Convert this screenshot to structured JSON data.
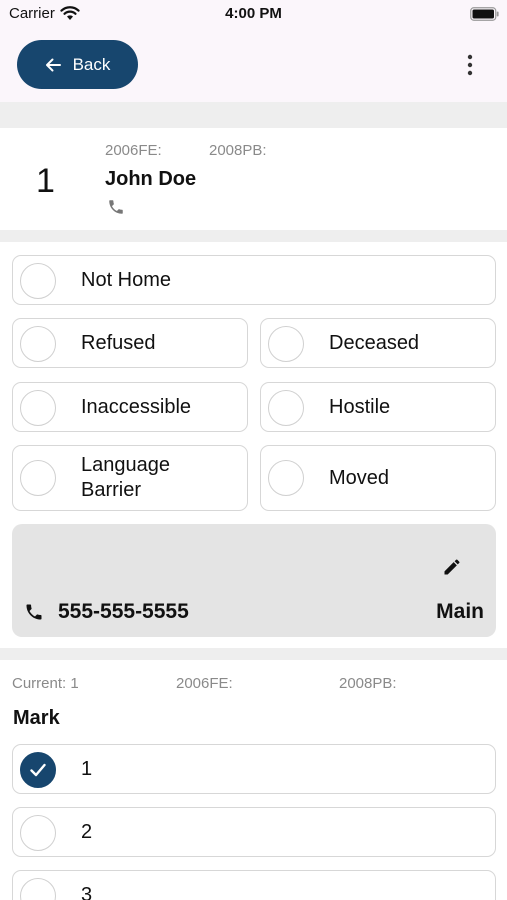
{
  "status_bar": {
    "carrier": "Carrier",
    "time": "4:00 PM"
  },
  "header": {
    "back_label": "Back"
  },
  "household": {
    "number": "1",
    "code_fe": "2006FE:",
    "code_pb": "2008PB:",
    "name": "John Doe"
  },
  "outcomes": [
    {
      "label": "Not Home",
      "selected": false
    },
    {
      "label": "Refused",
      "selected": false
    },
    {
      "label": "Deceased",
      "selected": false
    },
    {
      "label": "Inaccessible",
      "selected": false
    },
    {
      "label": "Hostile",
      "selected": false
    },
    {
      "label": "Language Barrier",
      "selected": false
    },
    {
      "label": "Moved",
      "selected": false
    }
  ],
  "phone": {
    "number": "555-555-5555",
    "type": "Main"
  },
  "mark_section": {
    "current": "Current: 1",
    "code_fe": "2006FE:",
    "code_pb": "2008PB:",
    "heading": "Mark",
    "options": [
      {
        "label": "1",
        "selected": true
      },
      {
        "label": "2",
        "selected": false
      },
      {
        "label": "3",
        "selected": false
      }
    ]
  },
  "colors": {
    "primary": "#17466e",
    "header_bg": "#fbf6fb",
    "card_gray": "#e4e4e4"
  }
}
